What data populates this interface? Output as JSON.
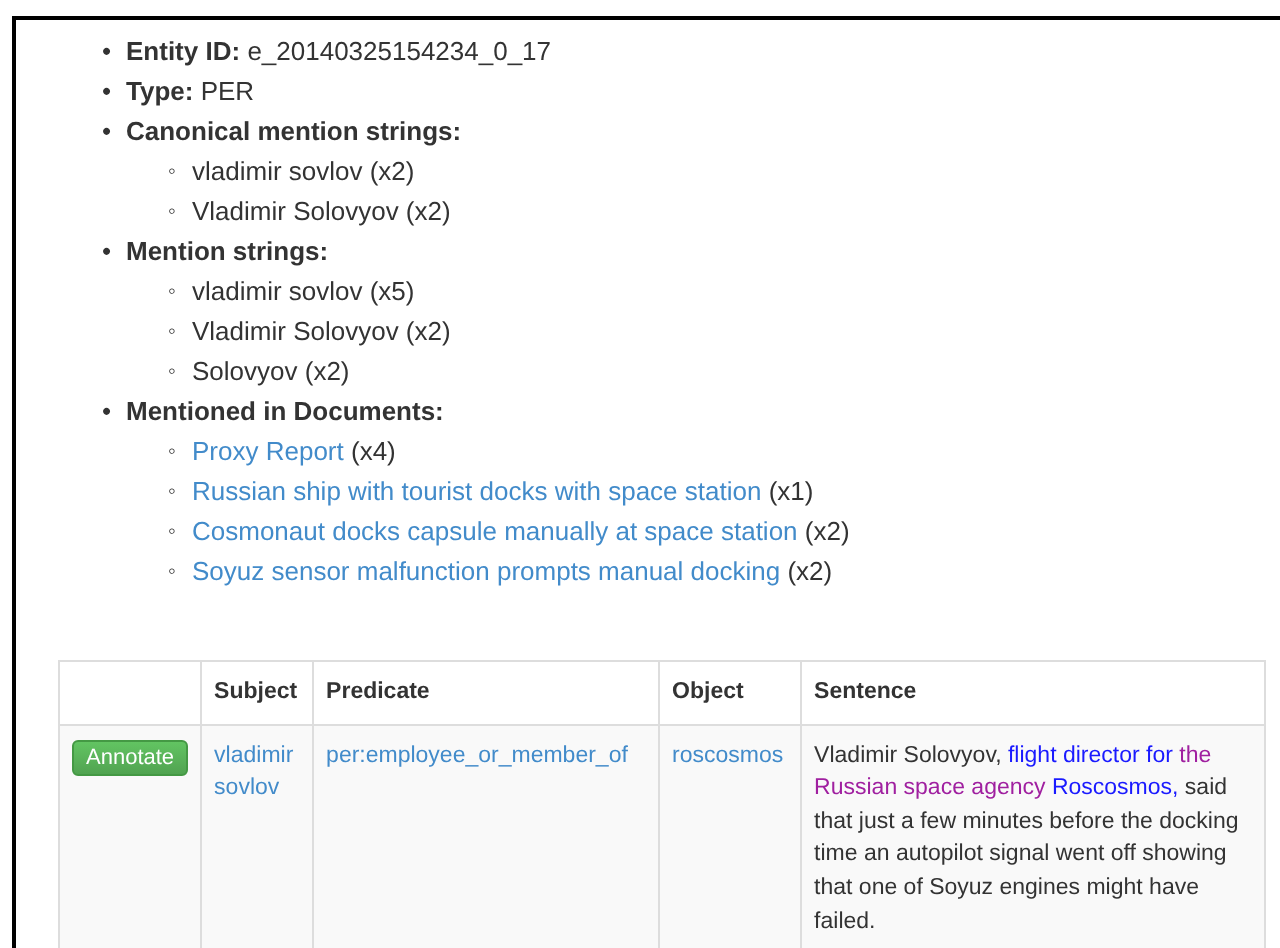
{
  "bullets": {
    "top": "•",
    "sub": "◦"
  },
  "entity": [
    {
      "label": "Entity ID:",
      "value": "e_20140325154234_0_17"
    },
    {
      "label": "Type:",
      "value": "PER"
    },
    {
      "label": "Canonical mention strings:",
      "children": [
        {
          "text": "vladimir sovlov (x2)"
        },
        {
          "text": "Vladimir Solovyov (x2)"
        }
      ]
    },
    {
      "label": "Mention strings:",
      "children": [
        {
          "text": "vladimir sovlov (x5)"
        },
        {
          "text": "Vladimir Solovyov (x2)"
        },
        {
          "text": "Solovyov (x2)"
        }
      ]
    },
    {
      "label": "Mentioned in Documents:",
      "children": [
        {
          "link": "Proxy Report",
          "count": "(x4)"
        },
        {
          "link": "Russian ship with tourist docks with space station",
          "count": "(x1)"
        },
        {
          "link": "Cosmonaut docks capsule manually at space station",
          "count": "(x2)"
        },
        {
          "link": "Soyuz sensor malfunction prompts manual docking",
          "count": "(x2)"
        }
      ]
    }
  ],
  "table": {
    "columns": [
      "",
      "Subject",
      "Predicate",
      "Object",
      "Sentence"
    ],
    "rows": [
      {
        "button": "Annotate",
        "subject": "vladimir sovlov",
        "predicate": "per:employee_or_member_of",
        "object": "roscosmos",
        "sentence": [
          {
            "text": "Vladimir Solovyov, ",
            "color": "#333333"
          },
          {
            "text": "flight director for ",
            "color": "#1a1aff"
          },
          {
            "text": "the Russian space agency",
            "color": "#a020a0"
          },
          {
            "text": " Roscosmos,",
            "color": "#1a1aff"
          },
          {
            "text": " said that just a few minutes before the docking time an autopilot signal went off showing that one of Soyuz engines might have failed.",
            "color": "#333333"
          }
        ]
      }
    ]
  }
}
